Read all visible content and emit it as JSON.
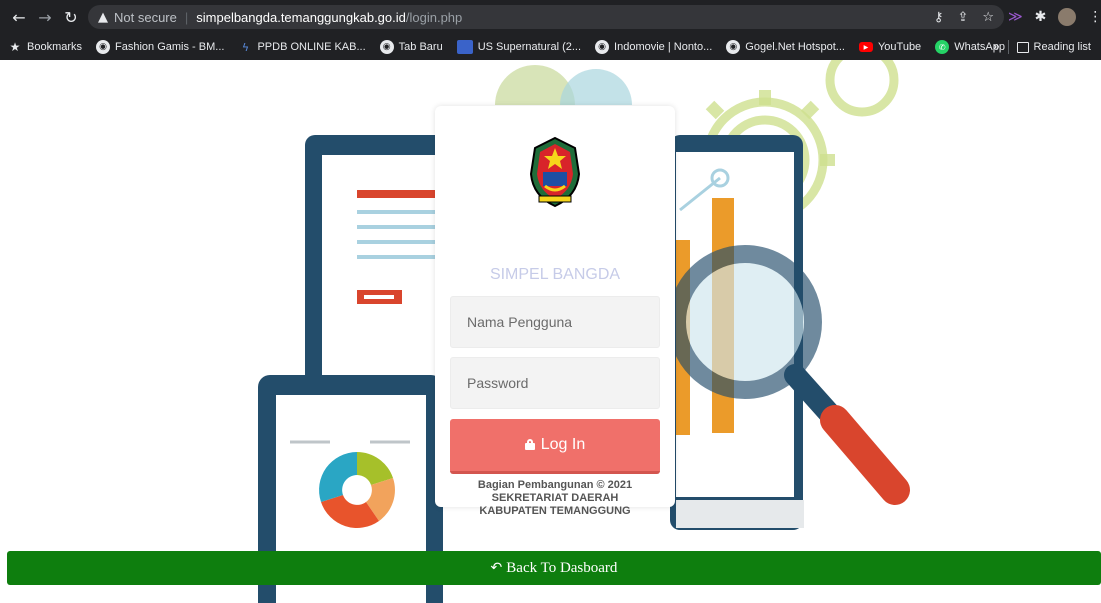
{
  "browser": {
    "omnibox": {
      "security_label": "Not secure",
      "host": "simpelbangda.temanggungkab.go.id",
      "path": "/login.php"
    },
    "bookmarks": [
      {
        "label": "Bookmarks",
        "icon": "star-icon"
      },
      {
        "label": "Fashion Gamis - BM...",
        "icon": "globe-icon"
      },
      {
        "label": "PPDB ONLINE KAB...",
        "icon": "ppdb-icon"
      },
      {
        "label": "Tab Baru",
        "icon": "globe-icon"
      },
      {
        "label": "US Supernatural (2...",
        "icon": "bfl-icon"
      },
      {
        "label": "Indomovie | Nonto...",
        "icon": "globe-icon"
      },
      {
        "label": "Gogel.Net Hotspot...",
        "icon": "globe-icon"
      },
      {
        "label": "YouTube",
        "icon": "youtube-icon"
      },
      {
        "label": "WhatsApp",
        "icon": "whatsapp-icon"
      }
    ],
    "reading_list": "Reading list"
  },
  "login": {
    "title": "SIMPEL BANGDA",
    "username_placeholder": "Nama Pengguna",
    "password_placeholder": "Password",
    "button_label": "Log In",
    "footer": [
      "Bagian Pembangunan © 2021",
      "SEKRETARIAT DAERAH",
      "KABUPATEN TEMANGGUNG"
    ]
  },
  "back_button": {
    "label": "Back To Dasboard",
    "color": "#0e7e0e"
  },
  "colors": {
    "login_button": "#f0706a",
    "title": "#c6cbe8"
  }
}
